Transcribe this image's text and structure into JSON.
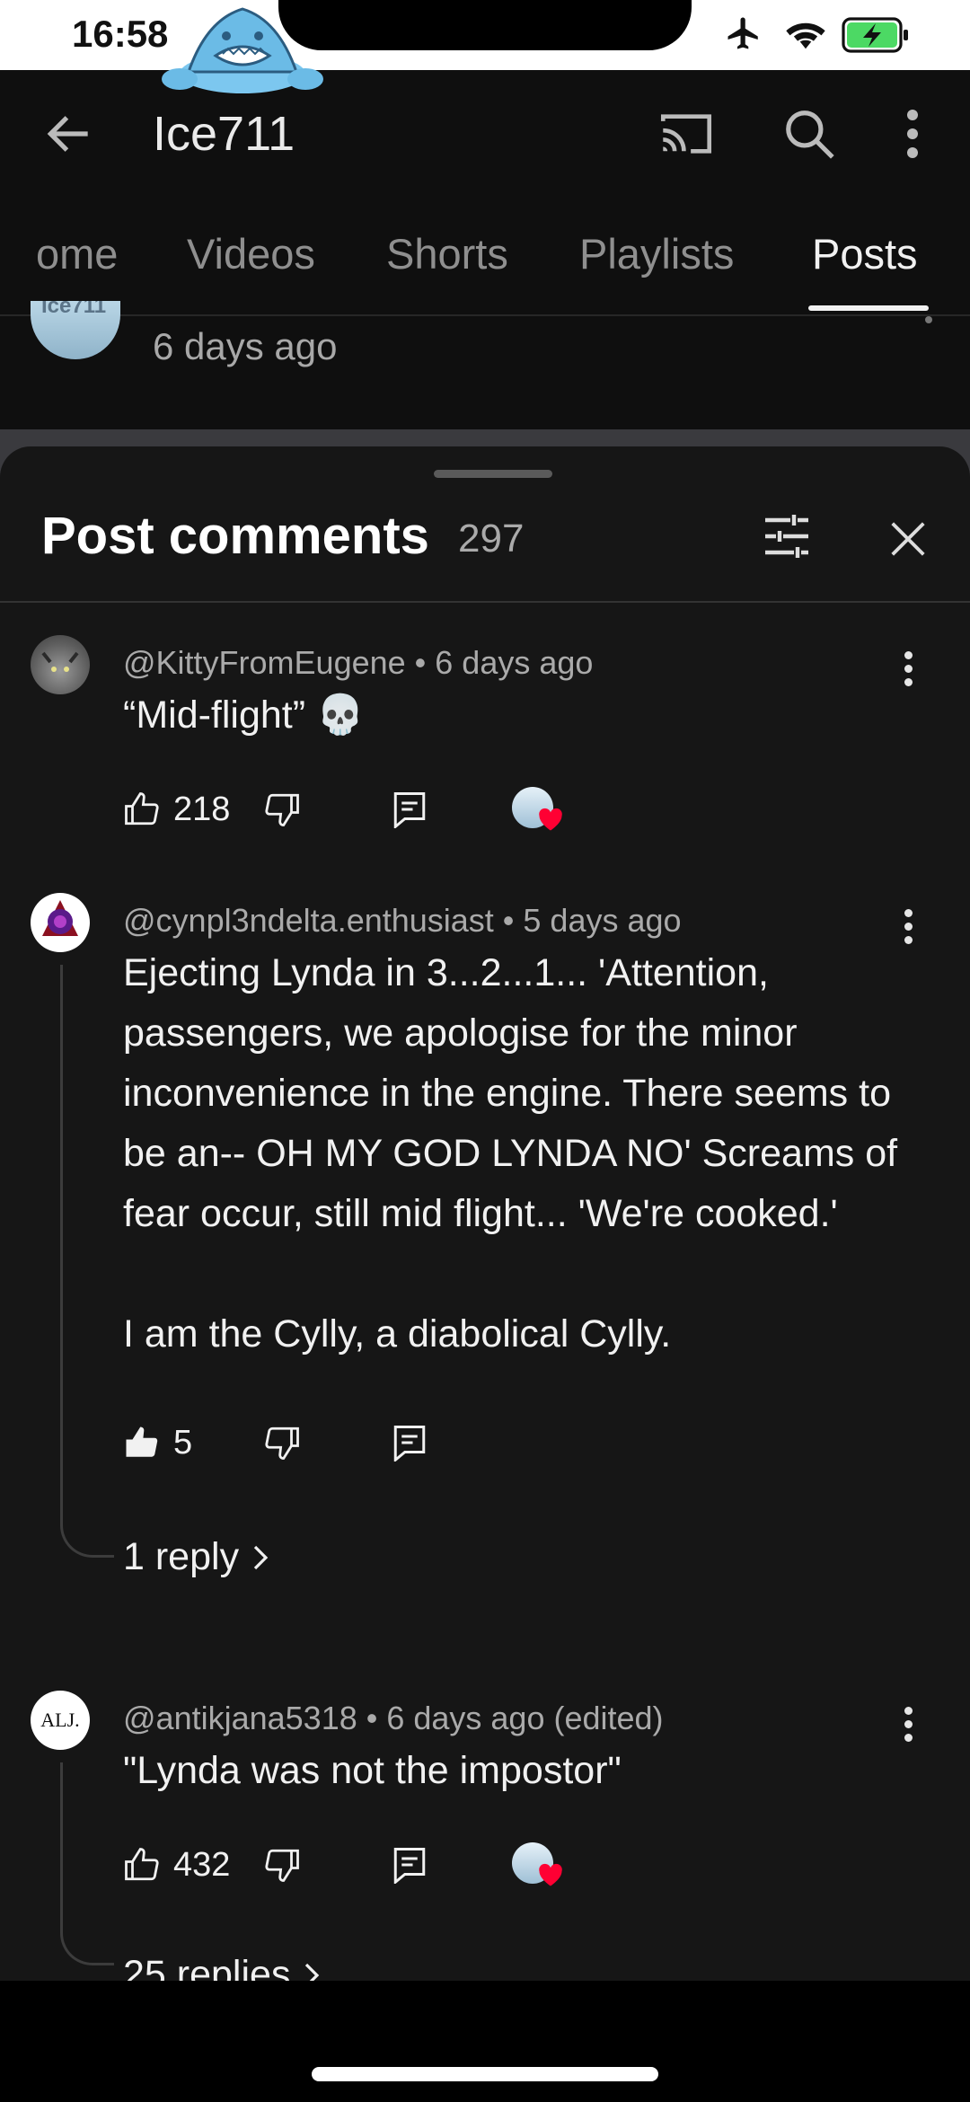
{
  "status_bar": {
    "time": "16:58",
    "icons": [
      "airplane-mode-icon",
      "wifi-icon",
      "battery-charging-icon"
    ],
    "battery_color": "#4cd964"
  },
  "header": {
    "channel_title": "Ice711",
    "icons": [
      "back-arrow-icon",
      "cast-icon",
      "search-icon",
      "more-vert-icon"
    ]
  },
  "tabs": [
    {
      "label": "ome",
      "active": false
    },
    {
      "label": "Videos",
      "active": false
    },
    {
      "label": "Shorts",
      "active": false
    },
    {
      "label": "Playlists",
      "active": false
    },
    {
      "label": "Posts",
      "active": true
    }
  ],
  "post": {
    "avatar_text": "Ice711",
    "time": "6 days ago"
  },
  "sheet": {
    "title": "Post comments",
    "count": "297",
    "icons": [
      "filter-sliders-icon",
      "close-icon"
    ]
  },
  "comments": [
    {
      "author": "@KittyFromEugene",
      "time": "6 days ago",
      "meta": "@KittyFromEugene • 6 days ago",
      "text": "“Mid-flight” 💀",
      "likes": "218",
      "liked": false,
      "creator_heart": true
    },
    {
      "author": "@cynpl3ndelta.enthusiast",
      "time": "5 days ago",
      "meta": "@cynpl3ndelta.enthusiast • 5 days ago",
      "text": "Ejecting Lynda in 3...2...1... 'Attention, passengers, we apologise for the minor inconvenience in the engine. There seems to be an-- OH MY GOD LYNDA NO' Screams of fear occur, still mid flight... 'We're cooked.'\n\nI am the Cylly, a diabolical Cylly.",
      "likes": "5",
      "liked": true,
      "creator_heart": false,
      "replies": "1 reply"
    },
    {
      "author": "@antikjana5318",
      "time": "6 days ago (edited)",
      "meta": "@antikjana5318 • 6 days ago (edited)",
      "avatar_text": "ALJ.",
      "text": "\"Lynda was not the impostor\"",
      "likes": "432",
      "liked": false,
      "creator_heart": true,
      "replies": "25 replies"
    }
  ],
  "colors": {
    "background": "#0f0f0f",
    "sheet": "#161616",
    "heart": "#ff0033",
    "text_primary": "#f1f1f1",
    "text_secondary": "#aaaaaa"
  }
}
